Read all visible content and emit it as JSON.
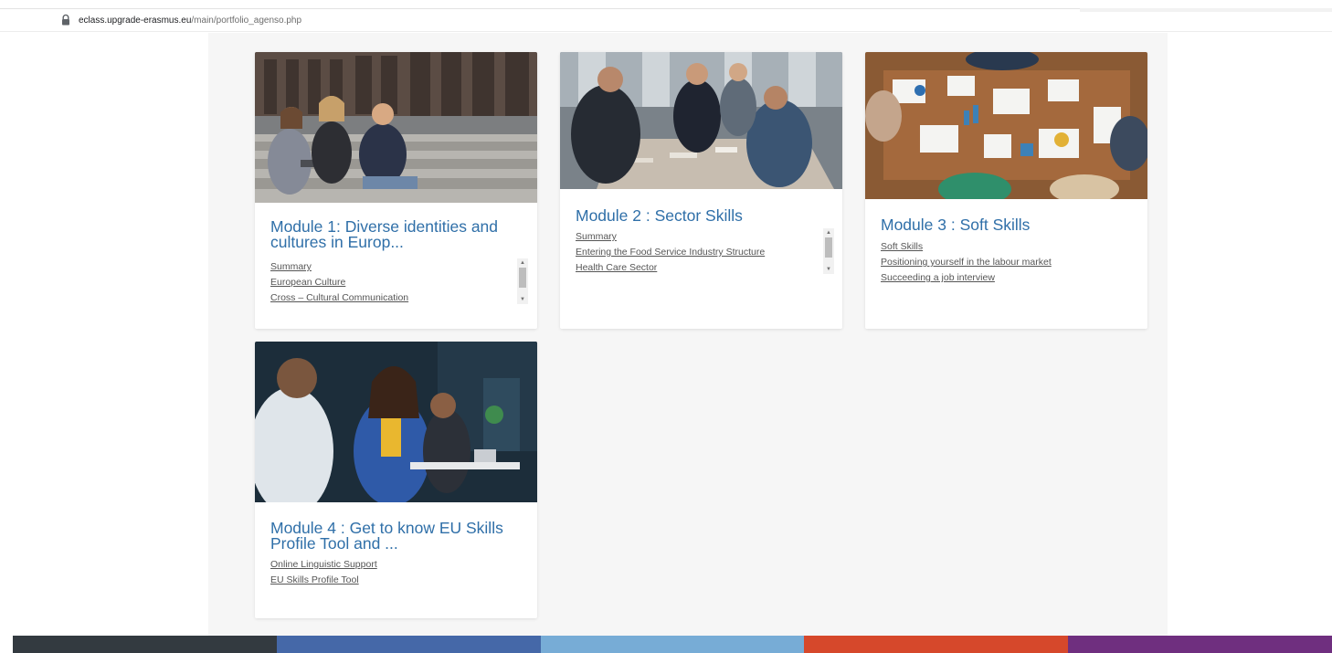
{
  "browser": {
    "url_host": "eclass.upgrade-erasmus.eu",
    "url_path": "/main/portfolio_agenso.php"
  },
  "modules": [
    {
      "title": "Module 1: Diverse identities and cultures in Europ...",
      "links": [
        "Summary",
        "European Culture",
        "Cross – Cultural Communication"
      ]
    },
    {
      "title": "Module 2 : Sector Skills",
      "links": [
        "Summary",
        "Entering the Food Service Industry Structure",
        "Health Care Sector"
      ]
    },
    {
      "title": "Module 3 : Soft Skills",
      "links": [
        "Soft Skills",
        "Positioning yourself in the labour market",
        "Succeeding a job interview"
      ]
    },
    {
      "title": "Module 4 : Get to know EU Skills Profile Tool and ...",
      "links": [
        "Online Linguistic Support",
        "EU Skills Profile Tool"
      ]
    }
  ],
  "colors": {
    "title_blue": "#2f6fa8",
    "footer": [
      "#333a40",
      "#4568a8",
      "#77acd6",
      "#d6482b",
      "#6f2f7f"
    ]
  }
}
